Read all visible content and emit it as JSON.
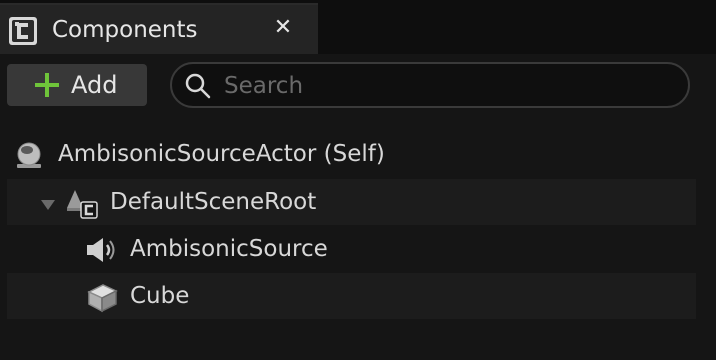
{
  "tab": {
    "title": "Components",
    "close_glyph": "✕",
    "icon": "blueprint-c-icon"
  },
  "toolbar": {
    "add_label": "Add",
    "add_icon": "plus-icon",
    "search_placeholder": "Search",
    "search_value": "",
    "search_icon": "search-icon"
  },
  "tree": {
    "items": [
      {
        "label": "AmbisonicSourceActor (Self)",
        "icon": "actor-sphere-icon",
        "depth": 0
      },
      {
        "label": "DefaultSceneRoot",
        "icon": "scene-root-icon",
        "depth": 1,
        "expanded": true
      },
      {
        "label": "AmbisonicSource",
        "icon": "speaker-icon",
        "depth": 2
      },
      {
        "label": "Cube",
        "icon": "cube-icon",
        "depth": 2
      }
    ]
  },
  "colors": {
    "background": "#151515",
    "tab_background": "#242424",
    "button_background": "#383838",
    "plus_green": "#6fc43a",
    "text": "#d8d8d8"
  }
}
